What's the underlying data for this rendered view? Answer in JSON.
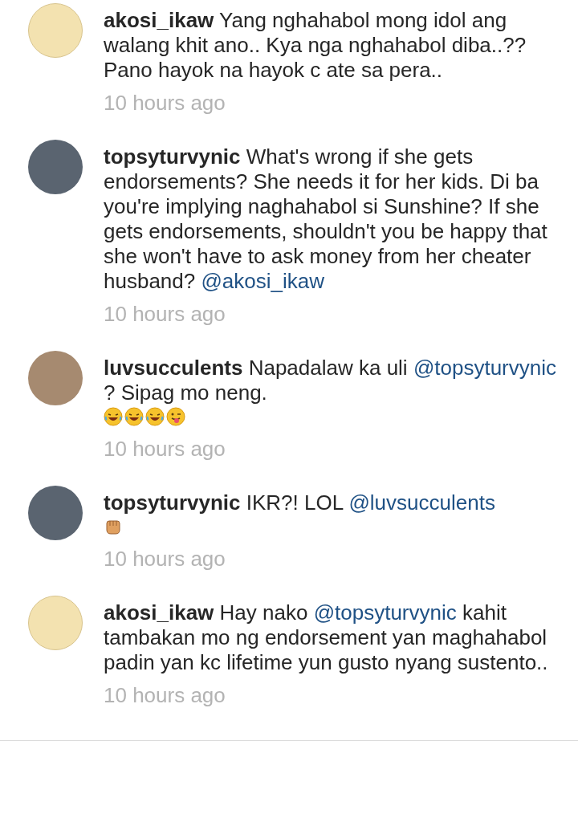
{
  "comments": [
    {
      "kind": "meme",
      "username": "akosi_ikaw",
      "segments": [
        {
          "kind": "text",
          "text": "Yang nghahabol mong idol ang walang khit ano.. Kya nga nghahabol diba..?? Pano hayok na hayok c ate sa pera.."
        }
      ],
      "time": "10 hours ago"
    },
    {
      "kind": "eye",
      "username": "topsyturvynic",
      "segments": [
        {
          "kind": "text",
          "text": "What's wrong if she gets endorsements? She needs it for her kids. Di ba you're implying naghahabol si Sunshine? If she gets endorsements, shouldn't you be happy that she won't have to ask money from her cheater husband?"
        },
        {
          "kind": "mention",
          "text": "@akosi_ikaw"
        }
      ],
      "time": "10 hours ago"
    },
    {
      "kind": "people",
      "username": "luvsucculents",
      "segments": [
        {
          "kind": "text",
          "text": "Napadalaw ka uli"
        },
        {
          "kind": "mention",
          "text": "@topsyturvynic"
        },
        {
          "kind": "text",
          "text": "? Sipag mo neng."
        }
      ],
      "emoji": [
        {
          "kind": "laughing"
        },
        {
          "kind": "laughing"
        },
        {
          "kind": "laughing"
        },
        {
          "kind": "tongue"
        }
      ],
      "time": "10 hours ago"
    },
    {
      "kind": "eye",
      "username": "topsyturvynic",
      "segments": [
        {
          "kind": "text",
          "text": "IKR?! LOL"
        },
        {
          "kind": "mention",
          "text": "@luvsucculents"
        }
      ],
      "emoji": [
        {
          "kind": "fist"
        }
      ],
      "time": "10 hours ago"
    },
    {
      "kind": "meme",
      "username": "akosi_ikaw",
      "segments": [
        {
          "kind": "text",
          "text": "Hay nako"
        },
        {
          "kind": "mention",
          "text": "@topsyturvynic"
        },
        {
          "kind": "text",
          "text": "kahit tambakan mo ng endorsement yan maghahabol padin yan kc lifetime yun gusto nyang sustento.."
        }
      ],
      "time": "10 hours ago"
    }
  ]
}
